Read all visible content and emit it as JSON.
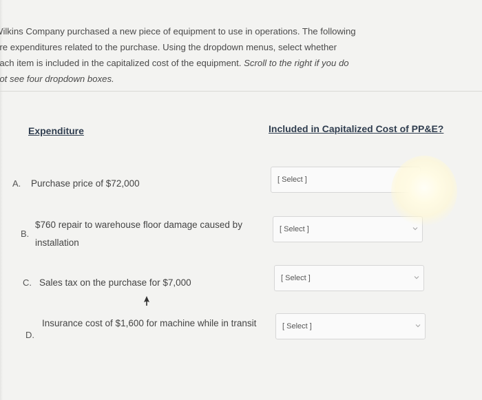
{
  "instructions": {
    "line1": "Wilkins Company purchased a new piece of equipment to use in operations. The following",
    "line2": "are expenditures related to the purchase. Using the dropdown menus, select whether",
    "line3_start": "each item is included in the capitalized cost of the equipment. ",
    "line3_emph": "Scroll to the right if you do",
    "line4_emph": "not see four dropdown boxes."
  },
  "table": {
    "col_expenditure": "Expenditure",
    "col_included": "Included in Capitalized Cost of PP&E?"
  },
  "rows": [
    {
      "letter": "A.",
      "text": "Purchase price of $72,000",
      "select": "[ Select ]"
    },
    {
      "letter": "B.",
      "text": "$760 repair to warehouse floor damage caused by installation",
      "select": "[ Select ]"
    },
    {
      "letter": "C.",
      "text": "Sales tax on the purchase for $7,000",
      "select": "[ Select ]"
    },
    {
      "letter": "D.",
      "text": "Insurance cost of $1,600 for machine while in transit",
      "select": "[ Select ]"
    }
  ],
  "icons": {
    "dropdown": "chevron-down-icon",
    "pointer": "mouse-cursor-icon"
  },
  "colors": {
    "background": "#f3f3f1",
    "header_text": "#2f3d4f",
    "select_border": "#d6d6d6"
  }
}
